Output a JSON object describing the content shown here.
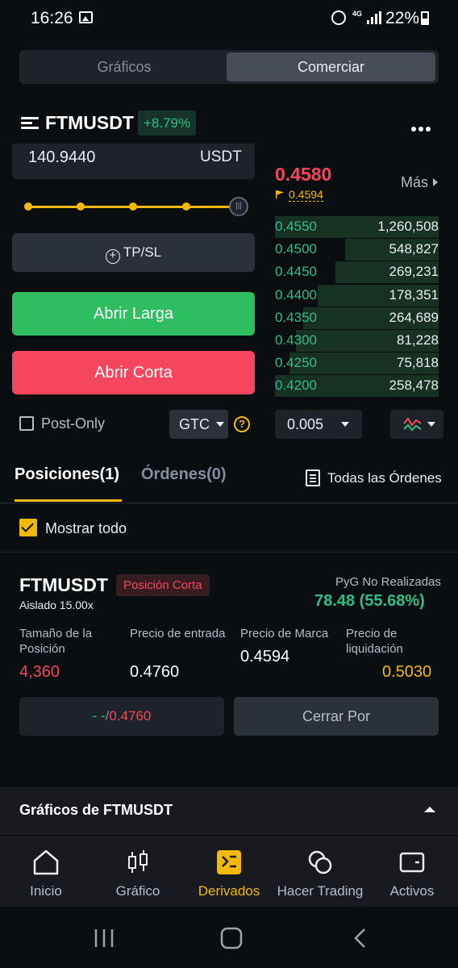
{
  "status_bar": {
    "time": "16:26",
    "network": "4G",
    "battery": "22%"
  },
  "top_tabs": {
    "charts": "Gráficos",
    "trade": "Comerciar"
  },
  "header": {
    "symbol": "FTMUSDT",
    "change": "+8.79%"
  },
  "order_form": {
    "amount_value": "140.9440",
    "amount_unit": "USDT",
    "slider_percent": 100,
    "tpsl_label": "TP/SL",
    "open_long_label": "Abrir Larga",
    "open_short_label": "Abrir Corta",
    "post_only_label": "Post-Only",
    "post_only_checked": false,
    "time_in_force": "GTC"
  },
  "order_book": {
    "last_price": "0.4580",
    "mark_price": "0.4594",
    "more_label": "Más",
    "bids": [
      {
        "price": "0.4550",
        "qty": "1,260,508",
        "depth": 1.0
      },
      {
        "price": "0.4500",
        "qty": "548,827",
        "depth": 0.57
      },
      {
        "price": "0.4450",
        "qty": "269,231",
        "depth": 0.63
      },
      {
        "price": "0.4400",
        "qty": "178,351",
        "depth": 0.74
      },
      {
        "price": "0.4350",
        "qty": "264,689",
        "depth": 0.83
      },
      {
        "price": "0.4300",
        "qty": "81,228",
        "depth": 0.87
      },
      {
        "price": "0.4250",
        "qty": "75,818",
        "depth": 0.91
      },
      {
        "price": "0.4200",
        "qty": "258,478",
        "depth": 1.0
      }
    ],
    "precision": "0.005"
  },
  "positions_tabs": {
    "positions": "Posiciones(1)",
    "orders": "Órdenes(0)",
    "all_orders": "Todas las Órdenes",
    "show_all": "Mostrar todo",
    "show_all_checked": true
  },
  "position": {
    "symbol": "FTMUSDT",
    "side": "Posición Corta",
    "margin_mode": "Aislado 15.00x",
    "pnl_label": "PyG No Realizadas",
    "pnl_value": "78.48 (55.68%)",
    "size_label": "Tamaño de la Posición",
    "size_value": "4,360",
    "entry_label": "Precio de entrada",
    "entry_value": "0.4760",
    "mark_label": "Precio de Marca",
    "mark_value": "0.4594",
    "liq_label": "Precio de liquidación",
    "liq_value": "0.5030",
    "tpsl_dash": "- -",
    "tpsl_sep": "/",
    "tpsl_price": "0.4760",
    "close_by_label": "Cerrar Por"
  },
  "chart_section": {
    "title": "Gráficos de FTMUSDT"
  },
  "bottom_nav": {
    "items": [
      {
        "label": "Inicio",
        "icon": "home-icon",
        "active": false
      },
      {
        "label": "Gráfico",
        "icon": "candlestick-icon",
        "active": false
      },
      {
        "label": "Derivados",
        "icon": "derivatives-icon",
        "active": true
      },
      {
        "label": "Hacer Trading",
        "icon": "trade-icon",
        "active": false
      },
      {
        "label": "Activos",
        "icon": "wallet-icon",
        "active": false
      }
    ]
  },
  "colors": {
    "accent": "#f0b90b",
    "buy": "#2ebd85",
    "sell": "#f6465d",
    "background": "#0b0e11"
  }
}
